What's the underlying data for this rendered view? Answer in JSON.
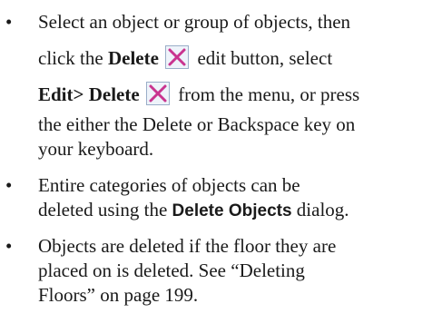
{
  "bullet": "•",
  "items": [
    {
      "line1": "Select an object or group of objects, then",
      "line2_pre": "click the ",
      "delete_label": "Delete",
      "icon": "delete-x-icon",
      "line2_post": " edit button, select",
      "menu_path": "Edit> Delete",
      "line3_post": " from the menu, or press",
      "line4": "the either the Delete or Backspace key on",
      "line5": "your keyboard."
    },
    {
      "line1": "Entire categories of objects can be",
      "line2_pre": "deleted using the ",
      "dialog_name": "Delete Objects",
      "line2_post": " dialog."
    },
    {
      "line1": "Objects are deleted if the floor they are",
      "line2": "placed on is deleted. See “Deleting",
      "line3": "Floors” on page 199."
    }
  ],
  "colors": {
    "icon_x": "#c9348f",
    "icon_bg": "#eef3fa",
    "icon_border": "#9aaec8"
  }
}
